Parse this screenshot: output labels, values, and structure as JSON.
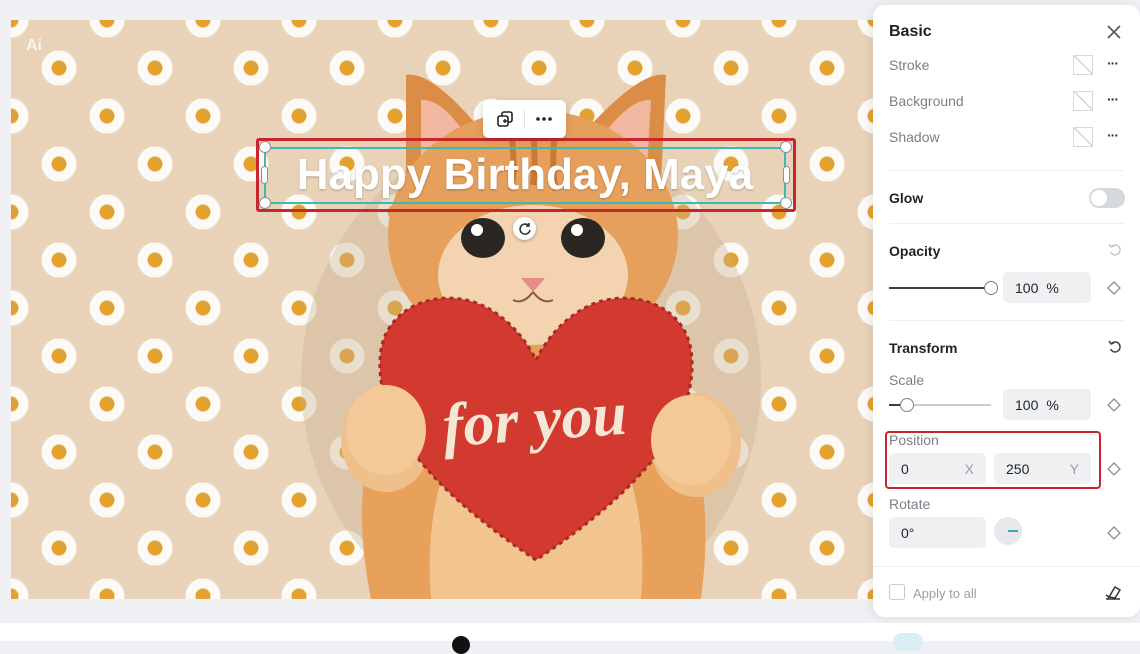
{
  "canvas": {
    "ai_badge": "Ai",
    "headline_text": "Happy Birthday, Maya",
    "heart_text": "for you"
  },
  "float_toolbar": {
    "duplicate_icon": "duplicate-icon",
    "more_icon": "more-icon"
  },
  "panel": {
    "title": "Basic",
    "rows": [
      {
        "label": "Stroke"
      },
      {
        "label": "Background"
      },
      {
        "label": "Shadow"
      }
    ],
    "glow": {
      "label": "Glow",
      "enabled": false
    },
    "opacity": {
      "title": "Opacity",
      "value": "100",
      "unit": "%",
      "level": 1.0
    },
    "transform": {
      "title": "Transform",
      "scale": {
        "label": "Scale",
        "value": "100",
        "unit": "%",
        "level": 0.18
      },
      "position": {
        "label": "Position",
        "x_value": "0",
        "x_axis": "X",
        "y_value": "250",
        "y_axis": "Y"
      },
      "rotate": {
        "label": "Rotate",
        "value": "0°"
      }
    },
    "footer": {
      "apply_to_all": "Apply to all",
      "checked": false
    }
  },
  "colors": {
    "selection_outline": "#c8262c",
    "selection_box": "#40b8b0",
    "accent": "#29b3a8"
  }
}
